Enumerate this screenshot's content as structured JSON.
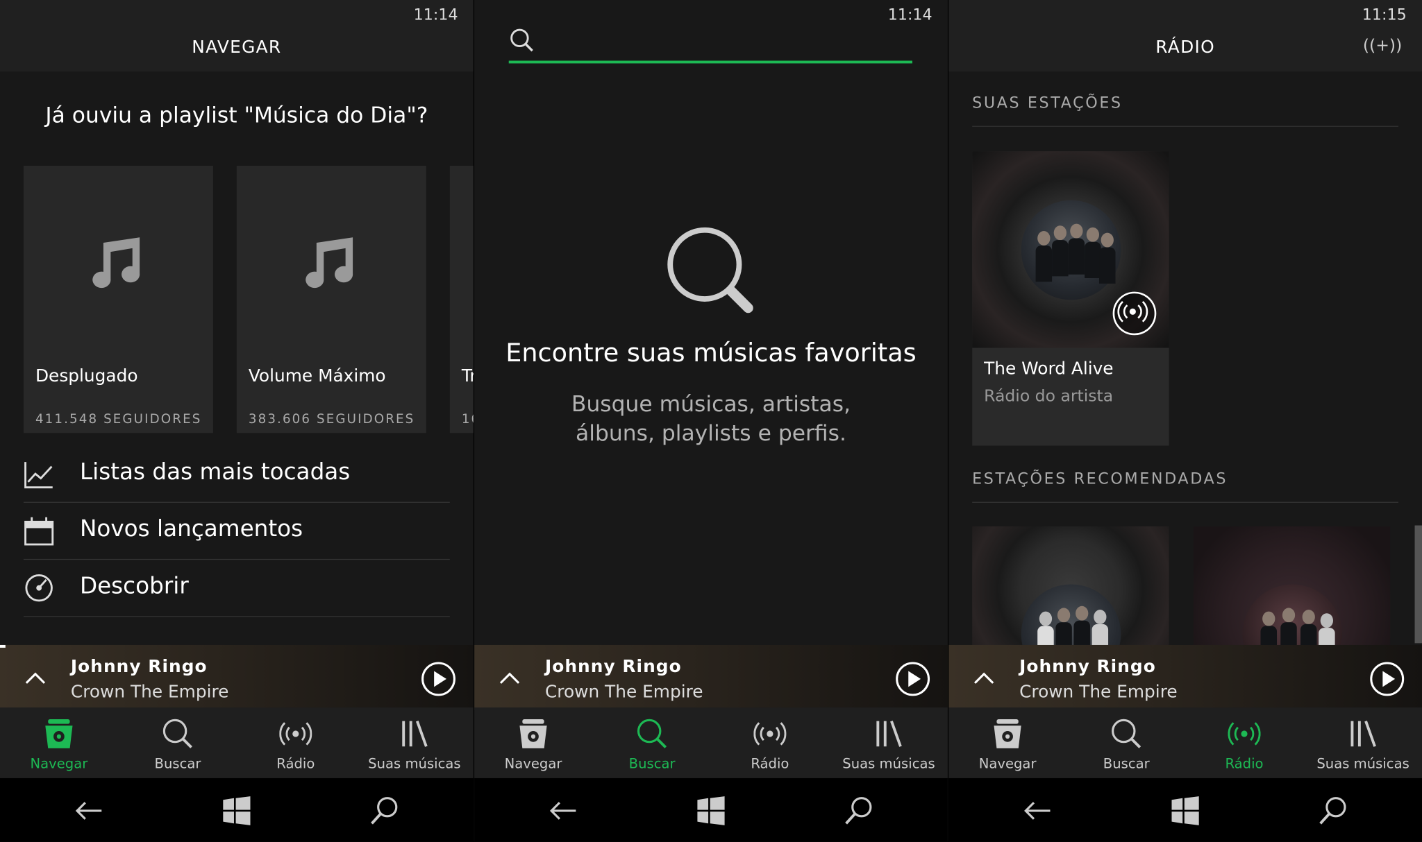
{
  "status": {
    "times": [
      "11:14",
      "11:14",
      "11:15"
    ]
  },
  "browse": {
    "title": "NAVEGAR",
    "promo_title": "Já ouviu a playlist \"Música do Dia\"?",
    "cards": [
      {
        "name": "Desplugado",
        "followers": "411.548 SEGUIDORES"
      },
      {
        "name": "Volume Máximo",
        "followers": "383.606 SEGUIDORES"
      },
      {
        "name": "Tr",
        "followers": "16"
      }
    ],
    "list": [
      {
        "label": "Listas das mais tocadas",
        "icon": "chart-icon"
      },
      {
        "label": "Novos lançamentos",
        "icon": "calendar-icon"
      },
      {
        "label": "Descobrir",
        "icon": "discover-icon"
      }
    ]
  },
  "search": {
    "placeholder": "",
    "empty_title": "Encontre suas músicas favoritas",
    "empty_subtitle": "Busque músicas, artistas, álbuns, playlists e perfis."
  },
  "radio": {
    "title": "RÁDIO",
    "add_icon": "((+))",
    "your_stations_label": "SUAS ESTAÇÕES",
    "station": {
      "name": "The Word Alive",
      "subtitle": "Rádio do artista"
    },
    "recommended_label": "ESTAÇÕES RECOMENDADAS"
  },
  "player": {
    "track": "Johnny Ringo",
    "artist": "Crown The Empire"
  },
  "nav": {
    "items": [
      {
        "label": "Navegar",
        "icon": "browse-icon"
      },
      {
        "label": "Buscar",
        "icon": "search-icon"
      },
      {
        "label": "Rádio",
        "icon": "radio-icon"
      },
      {
        "label": "Suas músicas",
        "icon": "library-icon"
      }
    ],
    "active_per_panel": [
      "Navegar",
      "Buscar",
      "Rádio"
    ]
  },
  "colors": {
    "accent": "#1db954",
    "background": "#181818",
    "bar": "#202020"
  }
}
